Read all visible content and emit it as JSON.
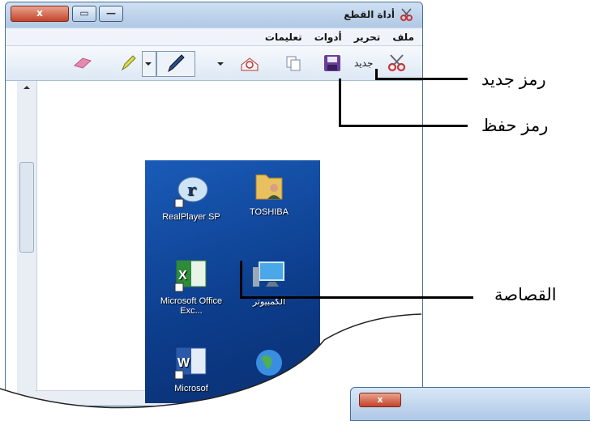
{
  "window": {
    "title": "أداة القطع",
    "controls": {
      "close": "x",
      "maximize": "▭",
      "minimize": "—"
    }
  },
  "menu": {
    "items": [
      "ملف",
      "تحرير",
      "أدوات",
      "تعليمات"
    ]
  },
  "toolbar": {
    "new_label": "جديد"
  },
  "desktop_icons": [
    {
      "name": "TOSHIBA",
      "icon": "folder-user-icon"
    },
    {
      "name": "RealPlayer SP",
      "icon": "realplayer-icon"
    },
    {
      "name": "الكمبيوتر",
      "icon": "computer-icon"
    },
    {
      "name": "Microsoft Office Exc...",
      "icon": "excel-icon"
    },
    {
      "name": "",
      "icon": "globe-icon"
    },
    {
      "name": "Microsof",
      "icon": "word-icon"
    }
  ],
  "annotations": {
    "new_icon": "رمز جديد",
    "save_icon": "رمز حفظ",
    "snip": "القصاصة"
  },
  "window2": {
    "close": "x"
  }
}
